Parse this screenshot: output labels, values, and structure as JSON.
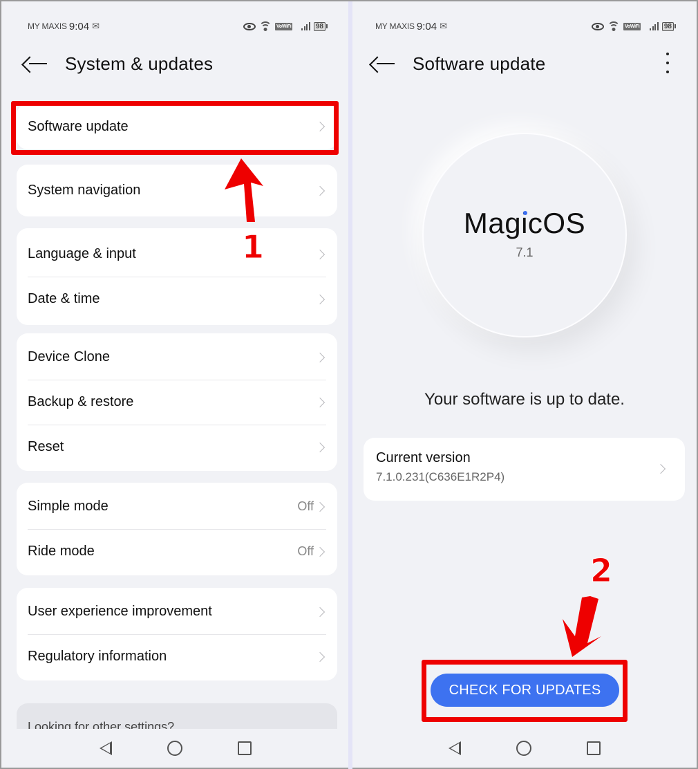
{
  "status_bar": {
    "carrier": "MY MAXIS",
    "time": "9:04",
    "mail_icon": "✉",
    "vowifi": "VoWiFi",
    "battery": "98"
  },
  "left_screen": {
    "title": "System & updates",
    "groups": [
      {
        "items": [
          {
            "label": "Software update"
          }
        ]
      },
      {
        "items": [
          {
            "label": "System navigation"
          }
        ]
      },
      {
        "items": [
          {
            "label": "Language & input"
          },
          {
            "label": "Date & time"
          }
        ]
      },
      {
        "items": [
          {
            "label": "Device Clone"
          },
          {
            "label": "Backup & restore"
          },
          {
            "label": "Reset"
          }
        ]
      },
      {
        "items": [
          {
            "label": "Simple mode",
            "value": "Off"
          },
          {
            "label": "Ride mode",
            "value": "Off"
          }
        ]
      },
      {
        "items": [
          {
            "label": "User experience improvement"
          },
          {
            "label": "Regulatory information"
          }
        ]
      }
    ],
    "other_settings": "Looking for other settings?"
  },
  "right_screen": {
    "title": "Software update",
    "logo_text": "MagicOS",
    "os_version": "7.1",
    "status_message": "Your software is up to date.",
    "current_version_label": "Current version",
    "current_version_value": "7.1.0.231(C636E1R2P4)",
    "check_button": "CHECK FOR UPDATES"
  },
  "annotations": {
    "step1": "1",
    "step2": "2",
    "highlight_color": "#ee0000"
  },
  "colors": {
    "accent": "#3d72f0",
    "background": "#f1f2f6"
  }
}
